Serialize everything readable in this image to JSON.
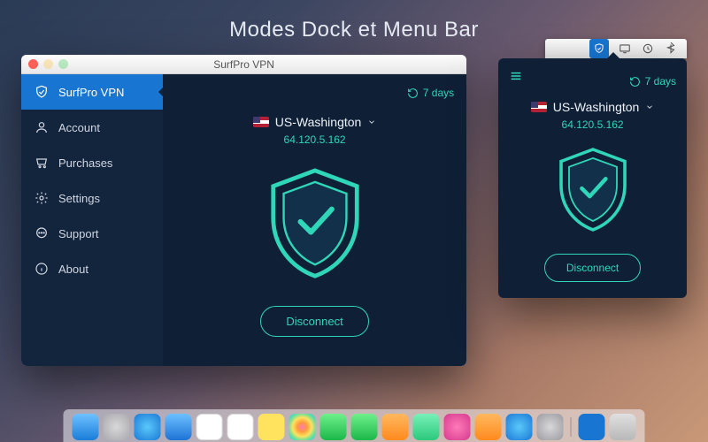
{
  "page_title": "Modes Dock et Menu Bar",
  "window": {
    "title": "SurfPro VPN"
  },
  "sidebar": [
    {
      "name": "surfpro-vpn",
      "label": "SurfPro VPN",
      "icon": "shield-check-icon",
      "active": true
    },
    {
      "name": "account",
      "label": "Account",
      "icon": "user-icon"
    },
    {
      "name": "purchases",
      "label": "Purchases",
      "icon": "cart-icon"
    },
    {
      "name": "settings",
      "label": "Settings",
      "icon": "gear-icon"
    },
    {
      "name": "support",
      "label": "Support",
      "icon": "chat-icon"
    },
    {
      "name": "about",
      "label": "About",
      "icon": "info-icon"
    }
  ],
  "status": {
    "days_left": "7 days",
    "server_name": "US-Washington",
    "ip": "64.120.5.162",
    "disconnect_label": "Disconnect"
  },
  "dock_icons": [
    "finder",
    "launchpad",
    "safari",
    "mail",
    "calendar",
    "reminders",
    "notes",
    "photos",
    "messages",
    "facetime",
    "pages",
    "numbers",
    "itunes",
    "ibooks",
    "appstore",
    "preferences",
    "sep",
    "vpn",
    "trash"
  ],
  "colors": {
    "accent": "#2fd6b8",
    "sidebar_active": "#1876d2",
    "panel": "#0f2036"
  }
}
